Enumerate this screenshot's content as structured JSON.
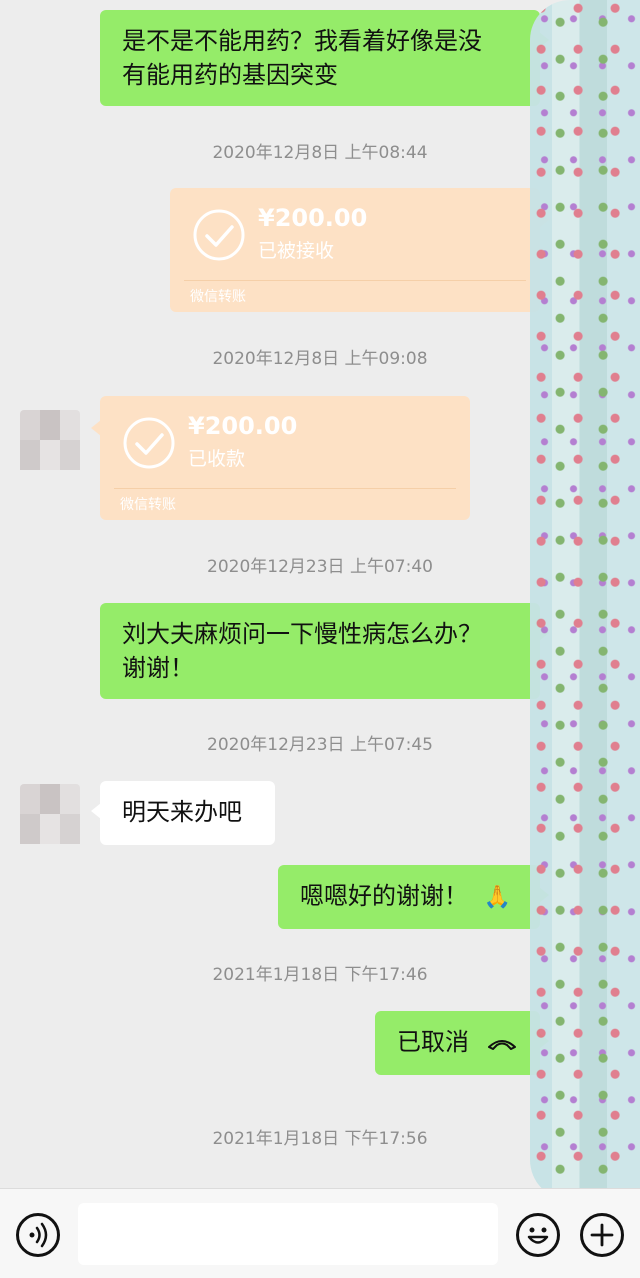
{
  "messages": {
    "m1_line1": "是不是不能用药？我看着好像是没",
    "m1_line2": "有能用药的基因突变",
    "t1": "2020年12月8日 上午08:44",
    "transfer1": {
      "amount": "¥200.00",
      "status": "已被接收",
      "kind": "微信转账"
    },
    "t2": "2020年12月8日 上午09:08",
    "transfer2": {
      "amount": "¥200.00",
      "status": "已收款",
      "kind": "微信转账"
    },
    "t3": "2020年12月23日 上午07:40",
    "m2_line1": "刘大夫麻烦问一下慢性病怎么办？",
    "m2_line2": "谢谢！",
    "t4": "2020年12月23日 上午07:45",
    "m3": "明天来办吧",
    "m4": "嗯嗯好的谢谢！",
    "m4_emoji": "🙏",
    "t5": "2021年1月18日 下午17:46",
    "m5": "已取消",
    "t6": "2021年1月18日 下午17:56"
  },
  "colors": {
    "sent_bubble": "#95ec69",
    "received_bubble": "#ffffff",
    "transfer_card": "#fde1c5",
    "background": "#ededed"
  },
  "icons": {
    "voice": "voice-icon",
    "emoji": "emoji-icon",
    "plus": "plus-icon",
    "check": "check-circle-icon",
    "phone": "phone-hangup-icon"
  }
}
